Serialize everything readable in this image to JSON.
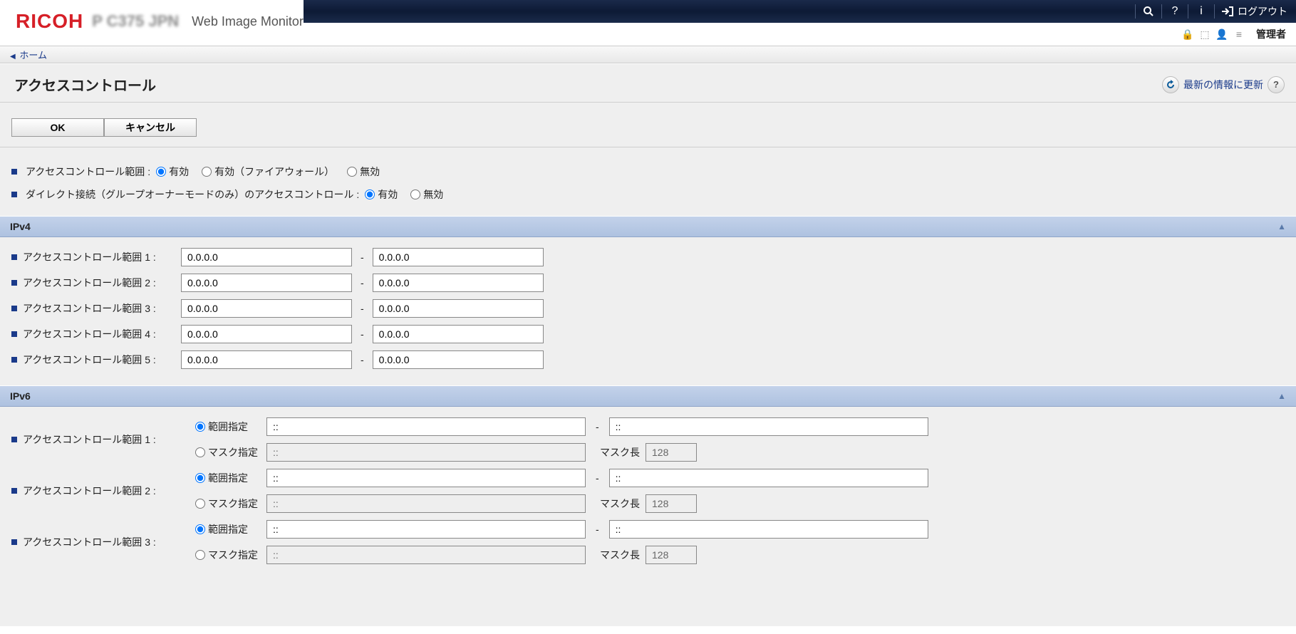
{
  "brand": {
    "logo": "RICOH",
    "subtitle": "Web Image Monitor"
  },
  "topbar": {
    "logout_label": "ログアウト"
  },
  "subbar": {
    "admin_label": "管理者"
  },
  "breadcrumb": {
    "home": "ホーム"
  },
  "page": {
    "title": "アクセスコントロール",
    "refresh_label": "最新の情報に更新"
  },
  "buttons": {
    "ok": "OK",
    "cancel": "キャンセル"
  },
  "options": {
    "range_label": "アクセスコントロール範囲 :",
    "range_opts": [
      "有効",
      "有効（ファイアウォール）",
      "無効"
    ],
    "range_selected": 0,
    "direct_label": "ダイレクト接続（グループオーナーモードのみ）のアクセスコントロール :",
    "direct_opts": [
      "有効",
      "無効"
    ],
    "direct_selected": 0
  },
  "ipv4": {
    "header": "IPv4",
    "rows": [
      {
        "label": "アクセスコントロール範囲 1 :",
        "a": "0.0.0.0",
        "b": "0.0.0.0"
      },
      {
        "label": "アクセスコントロール範囲 2 :",
        "a": "0.0.0.0",
        "b": "0.0.0.0"
      },
      {
        "label": "アクセスコントロール範囲 3 :",
        "a": "0.0.0.0",
        "b": "0.0.0.0"
      },
      {
        "label": "アクセスコントロール範囲 4 :",
        "a": "0.0.0.0",
        "b": "0.0.0.0"
      },
      {
        "label": "アクセスコントロール範囲 5 :",
        "a": "0.0.0.0",
        "b": "0.0.0.0"
      }
    ]
  },
  "ipv6": {
    "header": "IPv6",
    "sub_range": "範囲指定",
    "sub_mask": "マスク指定",
    "mask_len_label": "マスク長",
    "rows": [
      {
        "label": "アクセスコントロール範囲 1 :",
        "mode": 0,
        "a": "::",
        "b": "::",
        "mask": "::",
        "masklen": "128"
      },
      {
        "label": "アクセスコントロール範囲 2 :",
        "mode": 0,
        "a": "::",
        "b": "::",
        "mask": "::",
        "masklen": "128"
      },
      {
        "label": "アクセスコントロール範囲 3 :",
        "mode": 0,
        "a": "::",
        "b": "::",
        "mask": "::",
        "masklen": "128"
      }
    ]
  }
}
